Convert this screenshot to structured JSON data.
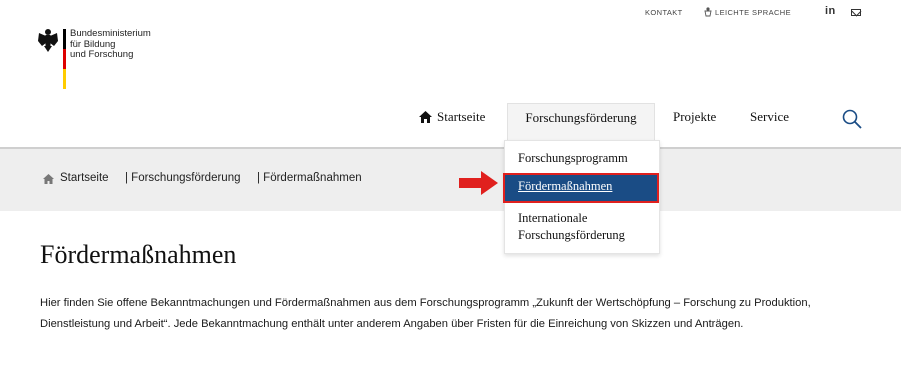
{
  "utility": {
    "kontakt": "KONTAKT",
    "leichte_sprache": "LEICHTE SPRACHE",
    "linkedin": "in"
  },
  "logo": {
    "line1": "Bundesministerium",
    "line2": "für Bildung",
    "line3": "und Forschung",
    "flag_colors": [
      "#000000",
      "#dd0000",
      "#ffcc00"
    ]
  },
  "nav": {
    "home": "Startseite",
    "forschungsfoerderung": "Forschungsförderung",
    "projekte": "Projekte",
    "service": "Service"
  },
  "dropdown": {
    "items": [
      {
        "label": "Forschungsprogramm"
      },
      {
        "label": "Fördermaßnahmen",
        "active": true
      },
      {
        "label_line1": "Internationale",
        "label_line2": "Forschungsförderung"
      }
    ],
    "active_bg": "#1a4c85",
    "highlight_color": "#e0201e"
  },
  "breadcrumb": {
    "items": [
      "Startseite",
      "| Forschungsförderung",
      "| Fördermaßnahmen"
    ]
  },
  "main": {
    "title": "Fördermaßnahmen",
    "intro": "Hier finden Sie offene Bekanntmachungen und Fördermaßnahmen aus dem Forschungsprogramm „Zukunft der Wertschöpfung – Forschung zu Produktion, Dienstleistung und Arbeit“. Jede Bekanntmachung enthält unter anderem Angaben über Fristen für die Einreichung von Skizzen und Anträgen."
  },
  "colors": {
    "breadcrumb_bg": "#eeeeee",
    "search_icon": "#1a4c85",
    "arrow": "#e0201e"
  }
}
